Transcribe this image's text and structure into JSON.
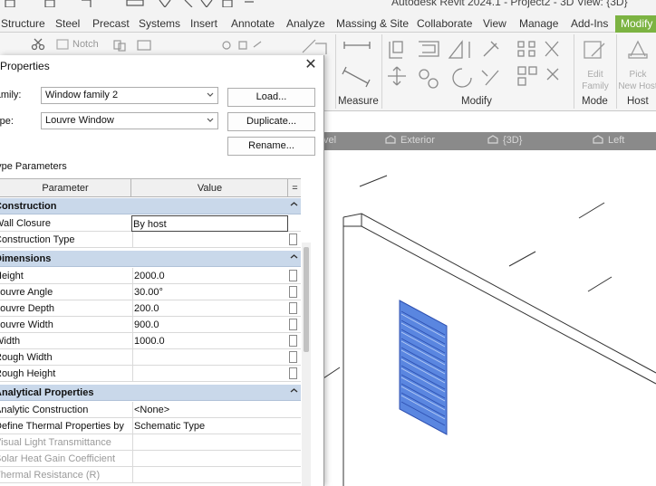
{
  "app": {
    "title": "Autodesk Revit 2024.1 - Project2 - 3D View: {3D}"
  },
  "ribbon": {
    "tabs": [
      {
        "label": "Structure"
      },
      {
        "label": "Steel"
      },
      {
        "label": "Precast"
      },
      {
        "label": "Systems"
      },
      {
        "label": "Insert"
      },
      {
        "label": "Annotate"
      },
      {
        "label": "Analyze"
      },
      {
        "label": "Massing & Site"
      },
      {
        "label": "Collaborate"
      },
      {
        "label": "View"
      },
      {
        "label": "Manage"
      },
      {
        "label": "Add-Ins"
      },
      {
        "label": "Modify"
      }
    ],
    "notch_label": "Notch",
    "panels": {
      "measure": "Measure",
      "modify": "Modify",
      "mode": "Mode",
      "host": "Host"
    },
    "mode_button": "Edit\nFamily",
    "host_button": "Pick\nNew Host",
    "accent_color": "#7cb342"
  },
  "view_tabs": [
    {
      "label": "vel"
    },
    {
      "label": "Exterior"
    },
    {
      "label": "{3D}"
    },
    {
      "label": "Left"
    }
  ],
  "dialog": {
    "title": "Properties",
    "family_label": "Family:",
    "family_value": "Window family 2",
    "type_label": "Type:",
    "type_value": "Louvre Window",
    "buttons": {
      "load": "Load...",
      "duplicate": "Duplicate...",
      "rename": "Rename..."
    },
    "section_title": "Type Parameters",
    "grid_headers": {
      "parameter": "Parameter",
      "value": "Value",
      "equals": "="
    },
    "groups": [
      {
        "name": "Construction",
        "rows": [
          {
            "param": "Wall Closure",
            "value": "By host",
            "editing": true
          },
          {
            "param": "Construction Type",
            "value": ""
          }
        ]
      },
      {
        "name": "Dimensions",
        "rows": [
          {
            "param": "Height",
            "value": "2000.0"
          },
          {
            "param": "Louvre Angle",
            "value": "30.00°"
          },
          {
            "param": "Louvre Depth",
            "value": "200.0"
          },
          {
            "param": "Louvre Width",
            "value": "900.0"
          },
          {
            "param": "Width",
            "value": "1000.0"
          },
          {
            "param": "Rough Width",
            "value": ""
          },
          {
            "param": "Rough Height",
            "value": ""
          }
        ]
      },
      {
        "name": "Analytical Properties",
        "rows": [
          {
            "param": "Analytic Construction",
            "value": "<None>"
          },
          {
            "param": "Define Thermal Properties by",
            "value": "Schematic Type"
          },
          {
            "param": "Visual Light Transmittance",
            "value": "",
            "gray": true
          },
          {
            "param": "Solar Heat Gain Coefficient",
            "value": "",
            "gray": true
          },
          {
            "param": "Thermal Resistance (R)",
            "value": "",
            "gray": true
          }
        ]
      }
    ]
  },
  "colors": {
    "group_row": "#c9d8ea",
    "louvre_fill": "#5a86e0",
    "louvre_edge": "#2d4fb0"
  }
}
